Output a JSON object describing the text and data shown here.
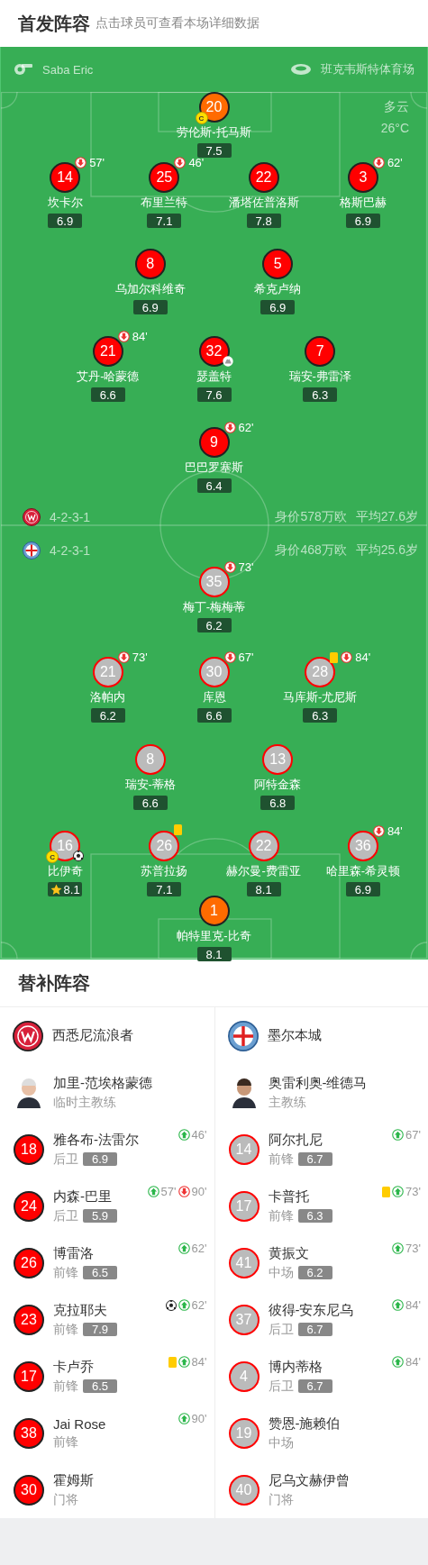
{
  "header": {
    "title": "首发阵容",
    "hint": "点击球员可查看本场详细数据"
  },
  "pitch": {
    "referee": "Saba Eric",
    "stadium": "班克韦斯特体育场",
    "weather": "多云",
    "temperature": "26°C",
    "home": {
      "kind": "home",
      "formation": "4-2-3-1",
      "value": "身价578万欧",
      "avg_age": "平均27.6岁",
      "rows": [
        [
          {
            "number": "20",
            "name": "劳伦斯-托马斯",
            "rating": "7.5",
            "goalkeeper": true,
            "captain": "C"
          }
        ],
        [
          {
            "number": "14",
            "name": "坎卡尔",
            "rating": "6.9",
            "events": [
              {
                "kind": "sub_off",
                "minute": "57'"
              }
            ]
          },
          {
            "number": "25",
            "name": "布里兰特",
            "rating": "7.1",
            "events": [
              {
                "kind": "sub_off",
                "minute": "46'"
              }
            ]
          },
          {
            "number": "22",
            "name": "潘塔佐普洛斯",
            "rating": "7.8"
          },
          {
            "number": "3",
            "name": "格斯巴赫",
            "rating": "6.9",
            "events": [
              {
                "kind": "sub_off",
                "minute": "62'"
              }
            ]
          }
        ],
        [
          {
            "number": "8",
            "name": "乌加尔科维奇",
            "rating": "6.9"
          },
          {
            "number": "5",
            "name": "希克卢纳",
            "rating": "6.9"
          }
        ],
        [
          {
            "number": "21",
            "name": "艾丹-哈蒙德",
            "rating": "6.6",
            "events": [
              {
                "kind": "sub_off",
                "minute": "84'"
              }
            ]
          },
          {
            "number": "32",
            "name": "瑟盖特",
            "rating": "7.6",
            "events": [
              {
                "kind": "assist"
              }
            ]
          },
          {
            "number": "7",
            "name": "瑞安-弗雷泽",
            "rating": "6.3"
          }
        ],
        [
          {
            "number": "9",
            "name": "巴巴罗塞斯",
            "rating": "6.4",
            "events": [
              {
                "kind": "sub_off",
                "minute": "62'"
              }
            ]
          }
        ]
      ]
    },
    "away": {
      "kind": "away",
      "formation": "4-2-3-1",
      "value": "身价468万欧",
      "avg_age": "平均25.6岁",
      "rows": [
        [
          {
            "number": "35",
            "name": "梅丁-梅梅蒂",
            "rating": "6.2",
            "events": [
              {
                "kind": "sub_off",
                "minute": "73'"
              }
            ]
          }
        ],
        [
          {
            "number": "21",
            "name": "洛帕内",
            "rating": "6.2",
            "events": [
              {
                "kind": "sub_off",
                "minute": "73'"
              }
            ]
          },
          {
            "number": "30",
            "name": "库恩",
            "rating": "6.6",
            "events": [
              {
                "kind": "sub_off",
                "minute": "67'"
              }
            ]
          },
          {
            "number": "28",
            "name": "马库斯-尤尼斯",
            "rating": "6.3",
            "events": [
              {
                "kind": "yellow"
              },
              {
                "kind": "sub_off",
                "minute": "84'"
              }
            ]
          }
        ],
        [
          {
            "number": "8",
            "name": "瑞安-蒂格",
            "rating": "6.6"
          },
          {
            "number": "13",
            "name": "阿特金森",
            "rating": "6.8"
          }
        ],
        [
          {
            "number": "16",
            "name": "比伊奇",
            "rating": "8.1",
            "captain": "C",
            "best": true,
            "events": [
              {
                "kind": "goal"
              }
            ]
          },
          {
            "number": "26",
            "name": "苏普拉扬",
            "rating": "7.1",
            "events": [
              {
                "kind": "yellow"
              }
            ]
          },
          {
            "number": "22",
            "name": "赫尔曼-费雷亚",
            "rating": "8.1"
          },
          {
            "number": "36",
            "name": "哈里森-希灵顿",
            "rating": "6.9",
            "events": [
              {
                "kind": "sub_off",
                "minute": "84'"
              }
            ]
          }
        ],
        [
          {
            "number": "1",
            "name": "帕特里克-比奇",
            "rating": "8.1",
            "goalkeeper": true
          }
        ]
      ]
    }
  },
  "bench": {
    "title": "替补阵容",
    "teams": [
      {
        "kind": "home",
        "team": "西悉尼流浪者",
        "coach": {
          "name": "加里-范埃格蒙德",
          "role": "临时主教练"
        },
        "players": [
          {
            "number": "18",
            "name": "雅各布-法雷尔",
            "position": "后卫",
            "rating": "6.9",
            "events": [
              {
                "kind": "sub_on",
                "minute": "46'"
              }
            ]
          },
          {
            "number": "24",
            "name": "内森-巴里",
            "position": "后卫",
            "rating": "5.9",
            "events": [
              {
                "kind": "sub_on",
                "minute": "57'"
              },
              {
                "kind": "sub_off",
                "minute": "90'"
              }
            ]
          },
          {
            "number": "26",
            "name": "博雷洛",
            "position": "前锋",
            "rating": "6.5",
            "events": [
              {
                "kind": "sub_on",
                "minute": "62'"
              }
            ]
          },
          {
            "number": "23",
            "name": "克拉耶夫",
            "position": "前锋",
            "rating": "7.9",
            "events": [
              {
                "kind": "goal"
              },
              {
                "kind": "sub_on",
                "minute": "62'"
              }
            ]
          },
          {
            "number": "17",
            "name": "卡卢乔",
            "position": "前锋",
            "rating": "6.5",
            "events": [
              {
                "kind": "yellow"
              },
              {
                "kind": "sub_on",
                "minute": "84'"
              }
            ]
          },
          {
            "number": "38",
            "name": "Jai Rose",
            "position": "前锋",
            "events": [
              {
                "kind": "sub_on",
                "minute": "90'"
              }
            ]
          },
          {
            "number": "30",
            "name": "霍姆斯",
            "position": "门将"
          }
        ]
      },
      {
        "kind": "away",
        "team": "墨尔本城",
        "coach": {
          "name": "奥雷利奥-维德马",
          "role": "主教练"
        },
        "players": [
          {
            "number": "14",
            "name": "阿尔扎尼",
            "position": "前锋",
            "rating": "6.7",
            "events": [
              {
                "kind": "sub_on",
                "minute": "67'"
              }
            ]
          },
          {
            "number": "17",
            "name": "卡普托",
            "position": "前锋",
            "rating": "6.3",
            "events": [
              {
                "kind": "yellow"
              },
              {
                "kind": "sub_on",
                "minute": "73'"
              }
            ]
          },
          {
            "number": "41",
            "name": "黄振文",
            "position": "中场",
            "rating": "6.2",
            "events": [
              {
                "kind": "sub_on",
                "minute": "73'"
              }
            ]
          },
          {
            "number": "37",
            "name": "彼得-安东尼乌",
            "position": "后卫",
            "rating": "6.7",
            "events": [
              {
                "kind": "sub_on",
                "minute": "84'"
              }
            ]
          },
          {
            "number": "4",
            "name": "博内蒂格",
            "position": "后卫",
            "rating": "6.7",
            "events": [
              {
                "kind": "sub_on",
                "minute": "84'"
              }
            ]
          },
          {
            "number": "19",
            "name": "赞恩-施赖伯",
            "position": "中场"
          },
          {
            "number": "40",
            "name": "尼乌文赫伊曾",
            "position": "门将"
          }
        ]
      }
    ]
  }
}
